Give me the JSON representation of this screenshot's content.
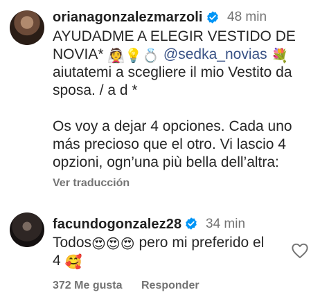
{
  "comments": [
    {
      "username": "orianagonzalezmarzoli",
      "time": "48 min",
      "lines": [
        {
          "segments": [
            {
              "t": "AYUDADME A ELEGIR VESTIDO DE"
            }
          ]
        },
        {
          "segments": [
            {
              "t": "NOVIA* "
            },
            {
              "e": "👰"
            },
            {
              "e": "💡"
            },
            {
              "e": "💍"
            },
            {
              "t": " "
            },
            {
              "m": "@sedka_novias"
            },
            {
              "t": " "
            },
            {
              "e": "💐"
            }
          ]
        },
        {
          "segments": [
            {
              "t": "aiutatemi a scegliere il mio Vestito da"
            }
          ]
        },
        {
          "segments": [
            {
              "t": "sposa. / a d *"
            }
          ]
        },
        {
          "segments": [
            {
              "t": ""
            }
          ]
        },
        {
          "segments": [
            {
              "t": "Os voy a dejar 4 opciones. Cada uno"
            }
          ]
        },
        {
          "segments": [
            {
              "t": "más precioso que el otro. Vi lascio 4"
            }
          ]
        },
        {
          "segments": [
            {
              "t": "opzioni, ogn’una più bella dell’altra:"
            }
          ]
        }
      ],
      "translate_label": "Ver traducción"
    },
    {
      "username": "facundogonzalez28",
      "time": "34 min",
      "lines": [
        {
          "segments": [
            {
              "t": "Todos"
            },
            {
              "e": "😍"
            },
            {
              "e": "😍"
            },
            {
              "e": "😍"
            },
            {
              "t": "  pero mi preferido el"
            }
          ]
        },
        {
          "segments": [
            {
              "t": "4 "
            },
            {
              "e": "🥰"
            }
          ]
        }
      ],
      "likes": "372 Me gusta",
      "reply_label": "Responder"
    }
  ],
  "icons": [
    "verified-badge-icon",
    "heart-outline-icon"
  ],
  "colors": {
    "verified": "#0095f6",
    "mention": "#385185",
    "muted": "#737373",
    "text": "#262626"
  }
}
